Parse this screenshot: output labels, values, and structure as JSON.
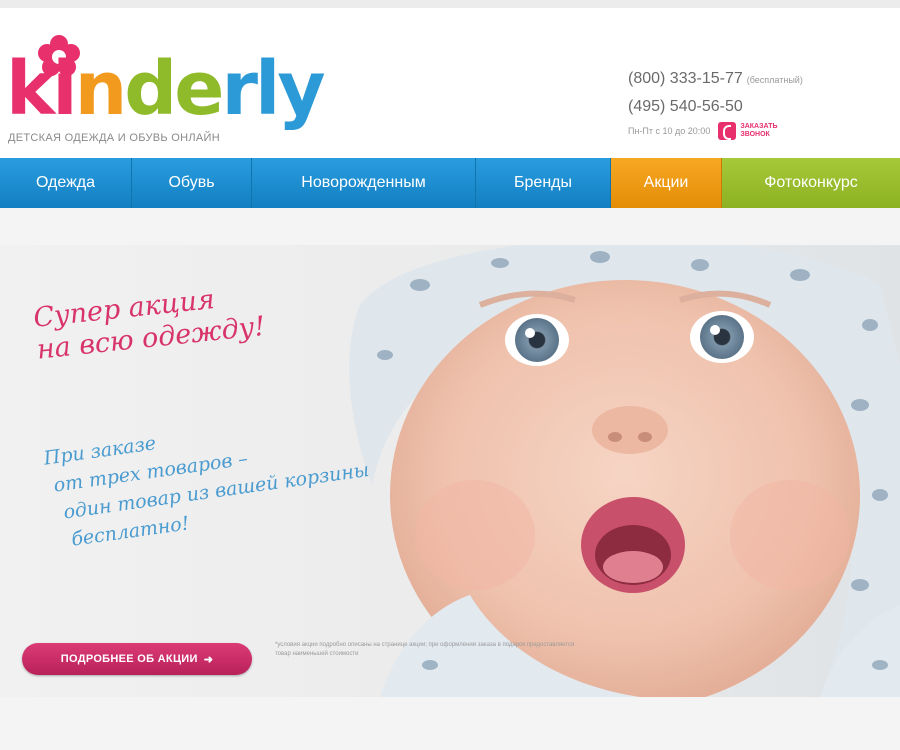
{
  "logo": {
    "letters": [
      {
        "ch": "k",
        "color": "#e8306d"
      },
      {
        "ch": "i",
        "color": "#e8306d"
      },
      {
        "ch": "n",
        "color": "#f29a1d"
      },
      {
        "ch": "d",
        "color": "#8fbb2a"
      },
      {
        "ch": "e",
        "color": "#8fbb2a"
      },
      {
        "ch": "r",
        "color": "#2c9ad6"
      },
      {
        "ch": "l",
        "color": "#2c9ad6"
      },
      {
        "ch": "y",
        "color": "#2c9ad6"
      }
    ],
    "subtitle": "ДЕТСКАЯ ОДЕЖДА И ОБУВЬ ОНЛАЙН"
  },
  "contacts": {
    "phone1": "(800) 333-15-77",
    "phone1_note": "(бесплатный)",
    "phone2": "(495) 540-56-50",
    "hours": "Пн-Пт с 10 до 20:00",
    "callback": "ЗАКАЗАТЬ ЗВОНОК"
  },
  "nav": {
    "items": [
      "Одежда",
      "Обувь",
      "Новорожденным",
      "Бренды",
      "Акции",
      "Фотоконкурс"
    ]
  },
  "banner": {
    "title_line1": "Супер акция",
    "title_line2": "на всю одежду!",
    "body_lines": [
      "При заказе",
      "от трех товаров –",
      "один товар из вашей корзины",
      "бесплатно!"
    ],
    "button_label": "ПОДРОБНЕЕ ОБ АКЦИИ",
    "footnote": "*условия акции подробно описаны на странице акции; при оформлении заказа в подарок предоставляется товар наименьшей стоимости"
  },
  "colors": {
    "nav_blue": "#1a8fd3",
    "nav_orange": "#f29a1d",
    "nav_green": "#96bb2a",
    "accent_pink": "#d8346a",
    "accent_blue": "#4a9bd0"
  }
}
